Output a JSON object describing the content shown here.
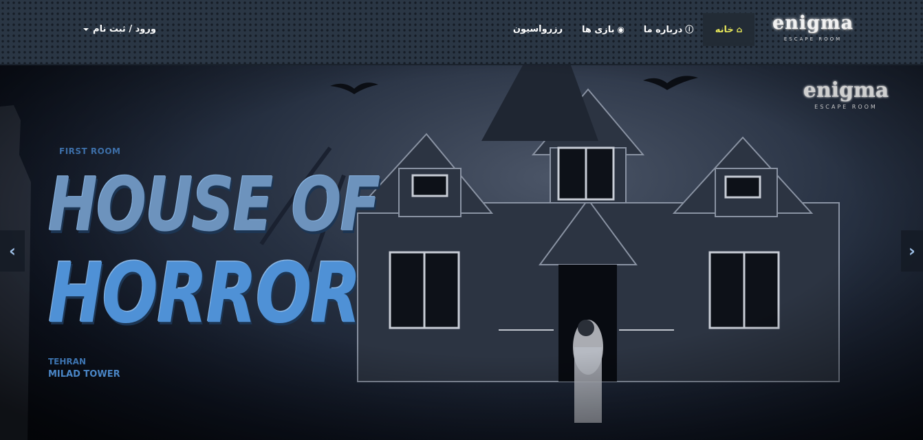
{
  "logo": {
    "word": "enigma",
    "subtitle": "ESCAPE ROOM"
  },
  "nav": {
    "home": {
      "label": "خانه",
      "icon": "home-icon"
    },
    "about": {
      "label": "درباره ما",
      "icon": "info-icon"
    },
    "games": {
      "label": "بازی ها",
      "icon": "gamepad-icon"
    },
    "reserve": {
      "label": "رزرواسیون"
    },
    "login": {
      "label": "ورود / ثبت نام",
      "icon": "caret-down-icon"
    }
  },
  "colors": {
    "active_nav": "#e8e85a",
    "title_blue": "#4f91d6",
    "navbar_bg": "#2a3644"
  },
  "hero": {
    "room_label": "FIRST ROOM",
    "title_line1": "HOUSE OF",
    "title_line2": "HORROR",
    "city": "TEHRAN",
    "place": "MILAD TOWER",
    "watermark_word": "enigma",
    "watermark_subtitle": "ESCAPE ROOM",
    "prev_arrow": "‹",
    "next_arrow": "›"
  }
}
